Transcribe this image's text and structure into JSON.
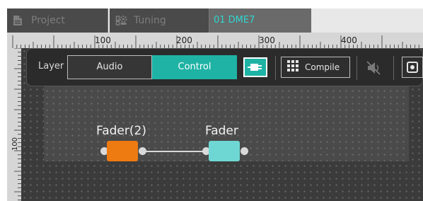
{
  "tabs": [
    {
      "label": "Project",
      "icon": "document-icon"
    },
    {
      "label": "Tuning",
      "icon": "tuning-icon"
    },
    {
      "label": "01 DME7",
      "active": true
    }
  ],
  "ruler": {
    "horizontal": [
      "100",
      "200",
      "300",
      "400"
    ],
    "vertical": [
      "100"
    ]
  },
  "toolbar": {
    "layer_label": "Layer",
    "audio_label": "Audio",
    "control_label": "Control",
    "control_selected": true,
    "compile_label": "Compile",
    "icons": [
      "plug-icon",
      "grid-icon",
      "mute-icon",
      "settings-icon"
    ]
  },
  "components": [
    {
      "label": "Fader(2)",
      "color": "#ee7a12"
    },
    {
      "label": "Fader",
      "color": "#6ed7d3"
    }
  ],
  "colors": {
    "accent": "#1fb3a5",
    "active_tab_text": "#2fd7d0",
    "canvas": "#3b3b3b"
  }
}
